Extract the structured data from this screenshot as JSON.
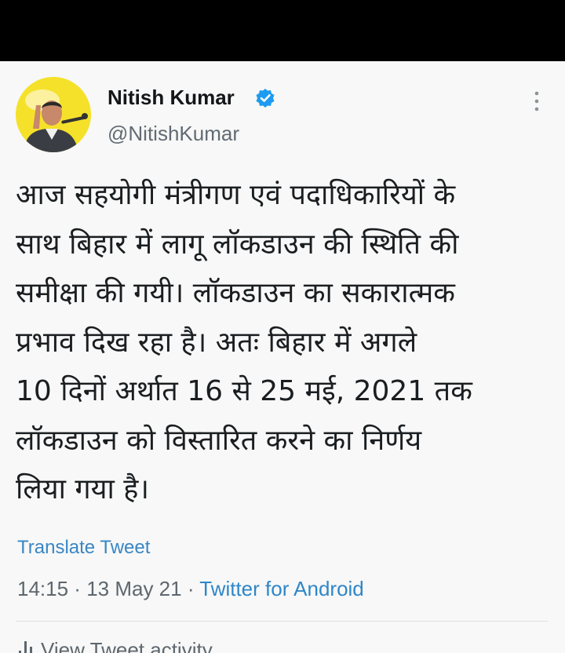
{
  "author": {
    "display_name": "Nitish Kumar",
    "handle": "@NitishKumar",
    "verified": true
  },
  "tweet": {
    "lines": [
      "आज सहयोगी मंत्रीगण एवं पदाधिकारियों के",
      "साथ बिहार में लागू लॉकडाउन की स्थिति की",
      "समीक्षा की गयी। लॉकडाउन का सकारात्मक",
      "प्रभाव दिख रहा है। अतः बिहार में अगले",
      "10 दिनों अर्थात 16 से 25 मई, 2021 तक",
      "लॉकडाउन को विस्तारित करने का निर्णय",
      "लिया गया है।"
    ],
    "translate_label": "Translate Tweet",
    "time": "14:15",
    "separator": " · ",
    "date": "13 May 21",
    "source": "Twitter for Android"
  },
  "activity": {
    "label": "View Tweet activity",
    "icon": "bar-chart-icon"
  },
  "colors": {
    "link": "#3a86c5",
    "verified_badge": "#1d9bf0",
    "avatar_background": "#f5e12a"
  }
}
